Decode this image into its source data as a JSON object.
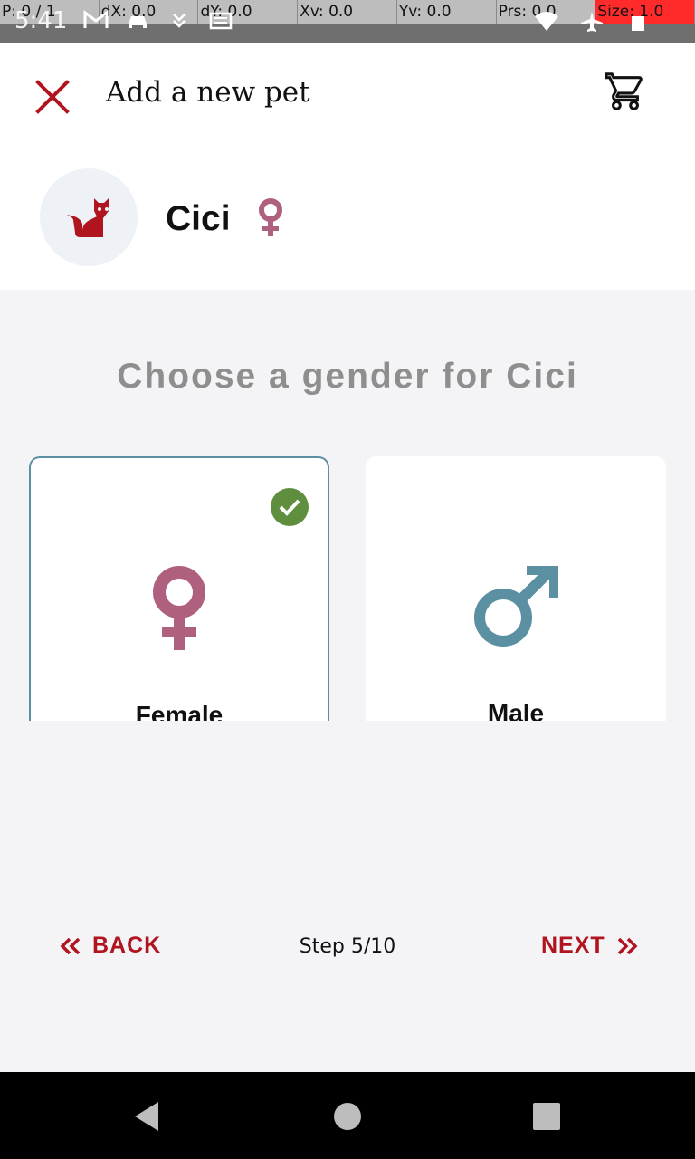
{
  "debug": {
    "p": "P: 0 / 1",
    "dx": "dX: 0.0",
    "dy": "dY: 0.0",
    "xv": "Xv: 0.0",
    "yv": "Yv: 0.0",
    "prs": "Prs: 0.0",
    "size": "Size: 1.0"
  },
  "status": {
    "time": "5:41",
    "icons_left": [
      "gmail-icon",
      "car-icon",
      "download-icon",
      "news-icon"
    ],
    "icons_right": [
      "wifi-icon",
      "airplane-icon",
      "battery-icon"
    ]
  },
  "header": {
    "title": "Add a new pet",
    "close_icon": "close-icon",
    "cart_icon": "cart-icon"
  },
  "pet": {
    "name": "Cici",
    "avatar_icon": "cat-icon",
    "gender_icon": "female-icon"
  },
  "prompt": "Choose a gender for Cici",
  "genders": [
    {
      "label": "Female",
      "icon": "female-icon",
      "selected": true
    },
    {
      "label": "Male",
      "icon": "male-icon",
      "selected": false
    }
  ],
  "nav": {
    "back_label": "BACK",
    "next_label": "NEXT",
    "step": "Step 5/10"
  },
  "colors": {
    "accent": "#b0151f",
    "female": "#b0607f",
    "male": "#5b8fa2",
    "check": "#5f8f3e",
    "prompt": "#8e8e8e"
  }
}
